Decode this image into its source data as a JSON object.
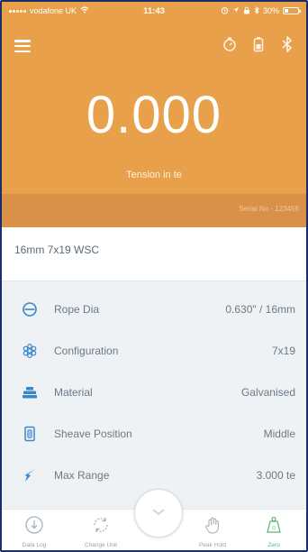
{
  "status_bar": {
    "carrier": "vodafone UK",
    "time": "11:43",
    "battery": "30%"
  },
  "header": {
    "reading": "0.000",
    "reading_label": "Tension in te",
    "serial": "Serial No - 123456"
  },
  "rope_title": "16mm 7x19 WSC",
  "info": [
    {
      "icon": "rope-dia-icon",
      "label": "Rope Dia",
      "value": "0.630\" / 16mm"
    },
    {
      "icon": "configuration-icon",
      "label": "Configuration",
      "value": "7x19"
    },
    {
      "icon": "material-icon",
      "label": "Material",
      "value": "Galvanised"
    },
    {
      "icon": "sheave-position-icon",
      "label": "Sheave Position",
      "value": "Middle"
    },
    {
      "icon": "max-range-icon",
      "label": "Max Range",
      "value": "3.000 te"
    }
  ],
  "bottom_nav": {
    "data_log": "Data Log",
    "change_unit": "Change Unit",
    "peak_hold": "Peak Hold",
    "zero": "Zero"
  },
  "colors": {
    "accent": "#e8a14a",
    "strip": "#d9914a",
    "icon_blue": "#3a86c8",
    "zero_green": "#5cb87a"
  }
}
